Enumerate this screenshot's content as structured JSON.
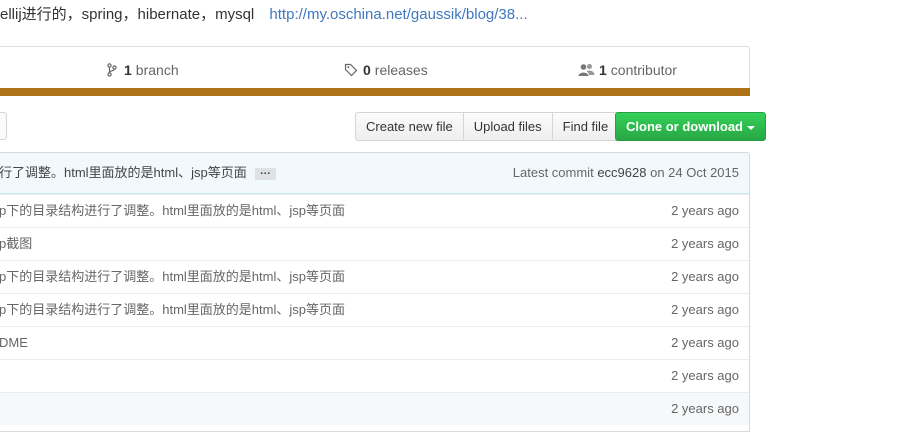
{
  "repo": {
    "description": "ellij进行的，spring，hibernate，mysql",
    "link": "http://my.oschina.net/gaussik/blog/38..."
  },
  "summary": {
    "branches": {
      "count": "1",
      "label": "branch",
      "icon": "git-branch-icon"
    },
    "releases": {
      "count": "0",
      "label": "releases",
      "icon": "tag-icon"
    },
    "contributors": {
      "count": "1",
      "label": "contributor",
      "icon": "people-icon"
    },
    "language_color": "#b07219"
  },
  "toolbar": {
    "create_new_file": "Create new file",
    "upload_files": "Upload files",
    "find_file": "Find file",
    "clone_or_download": "Clone or download"
  },
  "commit": {
    "message": "行了调整。html里面放的是html、jsp等页面",
    "ellipsis": "…",
    "latest_prefix": "Latest commit",
    "sha": "ecc9628",
    "date": "on 24 Oct 2015"
  },
  "files": [
    {
      "message": "p下的目录结构进行了调整。html里面放的是html、jsp等页面",
      "age": "2 years ago"
    },
    {
      "message": "p截图",
      "age": "2 years ago"
    },
    {
      "message": "p下的目录结构进行了调整。html里面放的是html、jsp等页面",
      "age": "2 years ago"
    },
    {
      "message": "p下的目录结构进行了调整。html里面放的是html、jsp等页面",
      "age": "2 years ago"
    },
    {
      "message": "DME",
      "age": "2 years ago"
    },
    {
      "message": "",
      "age": "2 years ago"
    },
    {
      "message": "",
      "age": "2 years ago"
    }
  ]
}
